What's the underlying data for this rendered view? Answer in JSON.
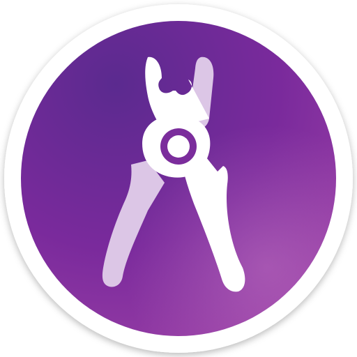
{
  "icon": {
    "name": "pliers-app-icon",
    "glyph": "pliers-icon",
    "colors": {
      "ring": "#ffffff",
      "gradient_start": "#5b2a8f",
      "gradient_mid": "#7a2a9c",
      "gradient_end": "#9a3fa6",
      "highlight": "#c77dc6",
      "glyph_solid": "#ffffff",
      "glyph_muted": "#dcc6e6"
    }
  }
}
